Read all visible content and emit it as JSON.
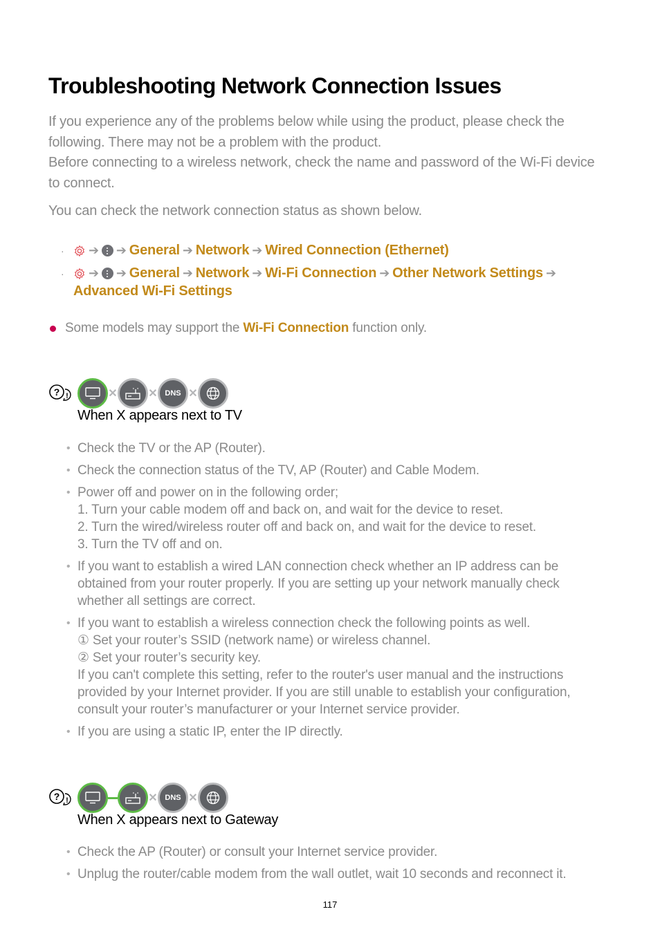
{
  "title": "Troubleshooting Network Connection Issues",
  "intro": {
    "line1": "If you experience any of the problems below while using the product, please check the following. There may not be a problem with the product.",
    "line2": "Before connecting to a wireless network, check the name and password of the Wi-Fi device to connect.",
    "status_note": "You can check the network connection status as shown below."
  },
  "paths": [
    {
      "icons": [
        "settings-gear-icon",
        "more-options-icon"
      ],
      "steps": [
        "General",
        "Network",
        "Wired Connection (Ethernet)"
      ]
    },
    {
      "icons": [
        "settings-gear-icon",
        "more-options-icon"
      ],
      "steps": [
        "General",
        "Network",
        "Wi-Fi Connection",
        "Other Network Settings"
      ],
      "continuation": "Advanced Wi-Fi Settings"
    }
  ],
  "arrow": "➔",
  "note": {
    "prefix": "Some models may support the ",
    "highlight": "Wi-Fi Connection",
    "suffix": " function only."
  },
  "sections": [
    {
      "heading": "When X appears next to TV",
      "diagram": {
        "nodes": [
          "tv",
          "router",
          "DNS",
          "internet"
        ],
        "node_status": [
          "ok",
          "fail",
          "fail",
          "fail"
        ],
        "links": [
          "x",
          "x",
          "x"
        ]
      },
      "items": [
        {
          "text": "Check the TV or the AP (Router)."
        },
        {
          "text": "Check the connection status of the TV, AP (Router) and Cable Modem."
        },
        {
          "text": "Power off and power on in the following order;",
          "sub": [
            "1. Turn your cable modem off and back on, and wait for the device to reset.",
            "2. Turn the wired/wireless router off and back on, and wait for the device to reset.",
            "3. Turn the TV off and on."
          ]
        },
        {
          "text": "If you want to establish a wired LAN connection check whether an IP address can be obtained from your router properly. If you are setting up your network manually check whether all settings are correct."
        },
        {
          "text": "If you want to establish a wireless connection check the following points as well.",
          "sub": [
            "① Set your router’s SSID (network name) or wireless channel.",
            "② Set your router’s security key.",
            "If you can't complete this setting, refer to the router's user manual and the instructions provided by your Internet provider. If you are still unable to establish your configuration, consult your router’s manufacturer or your Internet service provider."
          ]
        },
        {
          "text": "If you are using a static IP, enter the IP directly."
        }
      ]
    },
    {
      "heading": "When X appears next to Gateway",
      "diagram": {
        "nodes": [
          "tv",
          "router",
          "DNS",
          "internet"
        ],
        "node_status": [
          "ok",
          "ok",
          "fail",
          "fail"
        ],
        "links": [
          "ok",
          "x",
          "x"
        ]
      },
      "items": [
        {
          "text": "Check the AP (Router) or consult your Internet service provider."
        },
        {
          "text": "Unplug the router/cable modem from the wall outlet, wait 10 seconds and reconnect it."
        }
      ]
    }
  ],
  "page_number": "117",
  "colors": {
    "highlight": "#c28a1b",
    "body_text": "#8a8a8a",
    "ok_green": "#5dbb46",
    "bullet_red": "#c8004f"
  }
}
